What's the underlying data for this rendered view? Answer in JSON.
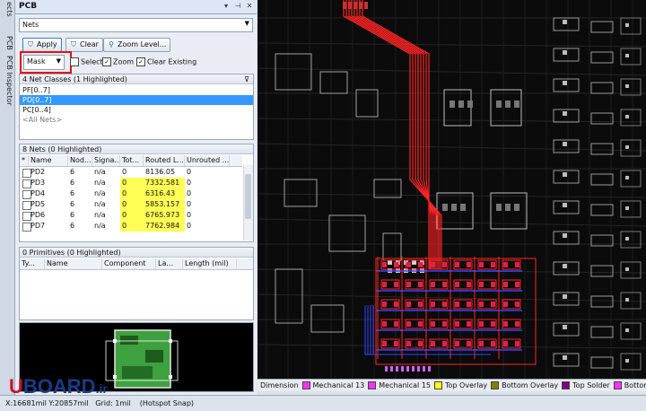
{
  "side_tabs": [
    "ects",
    "PCB",
    "PCB Inspector"
  ],
  "panel": {
    "title": "PCB",
    "nets_mode": "Nets",
    "buttons": {
      "apply": "Apply",
      "clear": "Clear",
      "zoom_level": "Zoom Level..."
    },
    "mask_mode": "Mask",
    "checks": {
      "select": "Select",
      "zoom": "Zoom",
      "clear_existing": "Clear Existing"
    },
    "net_classes": {
      "header": "4 Net Classes (1 Highlighted)",
      "items": [
        "PF[0..7]",
        "PD[0..7]",
        "PC[0..4]",
        "<All Nets>"
      ],
      "selected_index": 1
    },
    "nets": {
      "header": "8 Nets (0 Highlighted)",
      "columns": [
        "*",
        "Name",
        "Nod...",
        "Signa...",
        "Tot...",
        "Routed L...",
        "Unrouted ..."
      ],
      "rows": [
        {
          "name": "PD2",
          "nodes": "6",
          "signal": "n/a",
          "total": "0",
          "routed": "8136.05",
          "unrouted": "0",
          "yellow": false
        },
        {
          "name": "PD3",
          "nodes": "6",
          "signal": "n/a",
          "total": "0",
          "routed": "7332.581",
          "unrouted": "0",
          "yellow": true
        },
        {
          "name": "PD4",
          "nodes": "6",
          "signal": "n/a",
          "total": "0",
          "routed": "6316.43",
          "unrouted": "0",
          "yellow": true
        },
        {
          "name": "PD5",
          "nodes": "6",
          "signal": "n/a",
          "total": "0",
          "routed": "5853.157",
          "unrouted": "0",
          "yellow": true
        },
        {
          "name": "PD6",
          "nodes": "6",
          "signal": "n/a",
          "total": "0",
          "routed": "6765.973",
          "unrouted": "0",
          "yellow": true
        },
        {
          "name": "PD7",
          "nodes": "6",
          "signal": "n/a",
          "total": "0",
          "routed": "7762.984",
          "unrouted": "0",
          "yellow": true
        }
      ]
    },
    "primitives": {
      "header": "0 Primitives (0 Highlighted)",
      "columns": [
        "Ty...",
        "Name",
        "Component",
        "La...",
        "Length (mil)"
      ]
    }
  },
  "layers": [
    {
      "label": "Dimension",
      "color": "#ff33ff"
    },
    {
      "label": "Mechanical 13",
      "color": "#ff33ff"
    },
    {
      "label": "Mechanical 15",
      "color": "#ff33ff"
    },
    {
      "label": "Top Overlay",
      "color": "#ffff00"
    },
    {
      "label": "Bottom Overlay",
      "color": "#808000"
    },
    {
      "label": "Top Solder",
      "color": "#800080"
    },
    {
      "label": "Bottom So",
      "color": "#ff33ff"
    }
  ],
  "status": {
    "coords": "X:16681mil Y:20857mil",
    "grid": "Grid: 1mil",
    "snap": "(Hotspot Snap)"
  },
  "watermark": {
    "part1": "U",
    "part2": "BOARD",
    "part3": ".ir"
  },
  "colors": {
    "accent": "#3399ff",
    "trace_red": "#ff2020",
    "trace_blue": "#3344ff",
    "highlight_red": "#e81010"
  }
}
